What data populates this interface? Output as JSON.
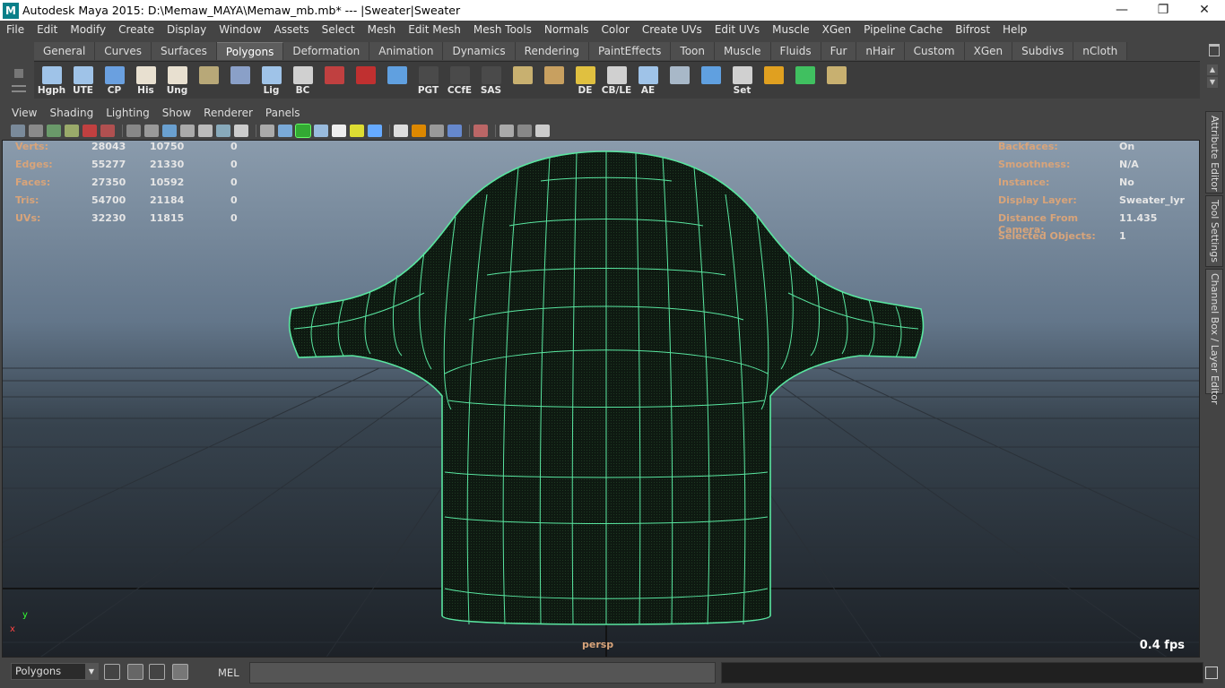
{
  "window": {
    "title": "Autodesk Maya 2015: D:\\Memaw_MAYA\\Memaw_mb.mb*   ---   |Sweater|Sweater",
    "app_icon_glyph": "M",
    "minimize_glyph": "—",
    "restore_glyph": "❐",
    "close_glyph": "✕"
  },
  "menubar": [
    "File",
    "Edit",
    "Modify",
    "Create",
    "Display",
    "Window",
    "Assets",
    "Select",
    "Mesh",
    "Edit Mesh",
    "Mesh Tools",
    "Normals",
    "Color",
    "Create UVs",
    "Edit UVs",
    "Muscle",
    "XGen",
    "Pipeline Cache",
    "Bifrost",
    "Help"
  ],
  "shelf": {
    "tabs": [
      "General",
      "Curves",
      "Surfaces",
      "Polygons",
      "Deformation",
      "Animation",
      "Dynamics",
      "Rendering",
      "PaintEffects",
      "Toon",
      "Muscle",
      "Fluids",
      "Fur",
      "nHair",
      "Custom",
      "XGen",
      "Subdivs",
      "nCloth"
    ],
    "active_tab": "Polygons",
    "buttons": [
      {
        "label": "Hgph",
        "icon": "window-icon",
        "color": "#9fc3e8"
      },
      {
        "label": "UTE",
        "icon": "window-icon",
        "color": "#9fc3e8"
      },
      {
        "label": "CP",
        "icon": "axis-icon",
        "color": "#6aa0e0"
      },
      {
        "label": "His",
        "icon": "edit-doc-icon",
        "color": "#e8e0d0"
      },
      {
        "label": "Ung",
        "icon": "edit-doc-icon",
        "color": "#e8e0d0"
      },
      {
        "label": "",
        "icon": "brick-icon",
        "color": "#b8a878"
      },
      {
        "label": "",
        "icon": "globe-search-icon",
        "color": "#8aa0c8"
      },
      {
        "label": "Lig",
        "icon": "window-icon",
        "color": "#9fc3e8"
      },
      {
        "label": "BC",
        "icon": "eye-icon",
        "color": "#d0d0d0"
      },
      {
        "label": "",
        "icon": "joint-icon",
        "color": "#c04040"
      },
      {
        "label": "",
        "icon": "camera-rig-icon",
        "color": "#c03030"
      },
      {
        "label": "",
        "icon": "curve-icon",
        "color": "#60a0e0"
      },
      {
        "label": "PGT",
        "icon": "blank-icon",
        "color": "#4a4a4a"
      },
      {
        "label": "CCfE",
        "icon": "blank-icon",
        "color": "#4a4a4a"
      },
      {
        "label": "SAS",
        "icon": "blank-icon",
        "color": "#4a4a4a"
      },
      {
        "label": "",
        "icon": "plane-uv-icon",
        "color": "#c8b070"
      },
      {
        "label": "",
        "icon": "plane-uv-icon",
        "color": "#c8a060"
      },
      {
        "label": "DE",
        "icon": "light-bulb-icon",
        "color": "#e0c040"
      },
      {
        "label": "CB/LE",
        "icon": "eye-icon",
        "color": "#d0d0d0"
      },
      {
        "label": "AE",
        "icon": "window-icon",
        "color": "#9fc3e8"
      },
      {
        "label": "",
        "icon": "pin-icon",
        "color": "#a8b8c8"
      },
      {
        "label": "",
        "icon": "curve-icon",
        "color": "#60a0e0"
      },
      {
        "label": "Set",
        "icon": "key-icon",
        "color": "#d0d0d0"
      },
      {
        "label": "",
        "icon": "target-icon",
        "color": "#e0a020"
      },
      {
        "label": "",
        "icon": "rotate-icon",
        "color": "#40c060"
      },
      {
        "label": "",
        "icon": "plane-uv-icon",
        "color": "#c8b070"
      }
    ]
  },
  "panel": {
    "menu": [
      "View",
      "Shading",
      "Lighting",
      "Show",
      "Renderer",
      "Panels"
    ]
  },
  "hud": {
    "left": [
      {
        "label": "Verts:",
        "a": "28043",
        "b": "10750",
        "c": "0"
      },
      {
        "label": "Edges:",
        "a": "55277",
        "b": "21330",
        "c": "0"
      },
      {
        "label": "Faces:",
        "a": "27350",
        "b": "10592",
        "c": "0"
      },
      {
        "label": "Tris:",
        "a": "54700",
        "b": "21184",
        "c": "0"
      },
      {
        "label": "UVs:",
        "a": "32230",
        "b": "11815",
        "c": "0"
      }
    ],
    "right": [
      {
        "label": "Backfaces:",
        "value": "On"
      },
      {
        "label": "Smoothness:",
        "value": "N/A"
      },
      {
        "label": "Instance:",
        "value": "No"
      },
      {
        "label": "Display Layer:",
        "value": "Sweater_lyr"
      },
      {
        "label": "Distance From Camera:",
        "value": "11.435"
      },
      {
        "label": "Selected Objects:",
        "value": "1"
      }
    ],
    "camera": "persp",
    "fps": "0.4 fps",
    "axis_x": "x",
    "axis_y": "y"
  },
  "side_tabs": [
    "Attribute Editor",
    "Tool Settings",
    "Channel Box / Layer Editor"
  ],
  "cmdline": {
    "mode": "Polygons",
    "lang": "MEL",
    "dropdown_glyph": "▼"
  },
  "colors": {
    "wire": "#59e6a0",
    "mesh": "#0f1a12",
    "hud_label": "#d8a47a"
  }
}
